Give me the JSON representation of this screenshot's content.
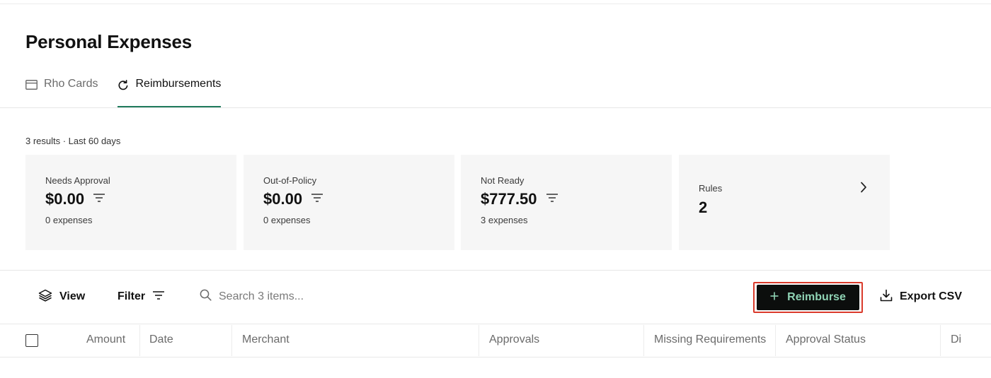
{
  "page": {
    "title": "Personal Expenses"
  },
  "tabs": [
    {
      "label": "Rho Cards",
      "icon": "card-icon",
      "active": false
    },
    {
      "label": "Reimbursements",
      "icon": "refresh-icon",
      "active": true
    }
  ],
  "results_summary": "3 results · Last 60 days",
  "summary_cards": [
    {
      "label": "Needs Approval",
      "amount": "$0.00",
      "sub": "0 expenses"
    },
    {
      "label": "Out-of-Policy",
      "amount": "$0.00",
      "sub": "0 expenses"
    },
    {
      "label": "Not Ready",
      "amount": "$777.50",
      "sub": "3 expenses"
    }
  ],
  "rules_card": {
    "label": "Rules",
    "value": "2"
  },
  "toolbar": {
    "view_label": "View",
    "filter_label": "Filter",
    "search_placeholder": "Search 3 items...",
    "reimburse_label": "Reimburse",
    "export_label": "Export CSV"
  },
  "table": {
    "columns": [
      "Amount",
      "Date",
      "Merchant",
      "Approvals",
      "Missing Requirements",
      "Approval Status",
      "Di"
    ]
  },
  "colors": {
    "accent": "#1f7a5c",
    "primary_button_bg": "#0c0e0d",
    "primary_button_text": "#8fd3b4",
    "highlight_outline": "#d93a2b",
    "card_bg": "#f6f6f6"
  }
}
